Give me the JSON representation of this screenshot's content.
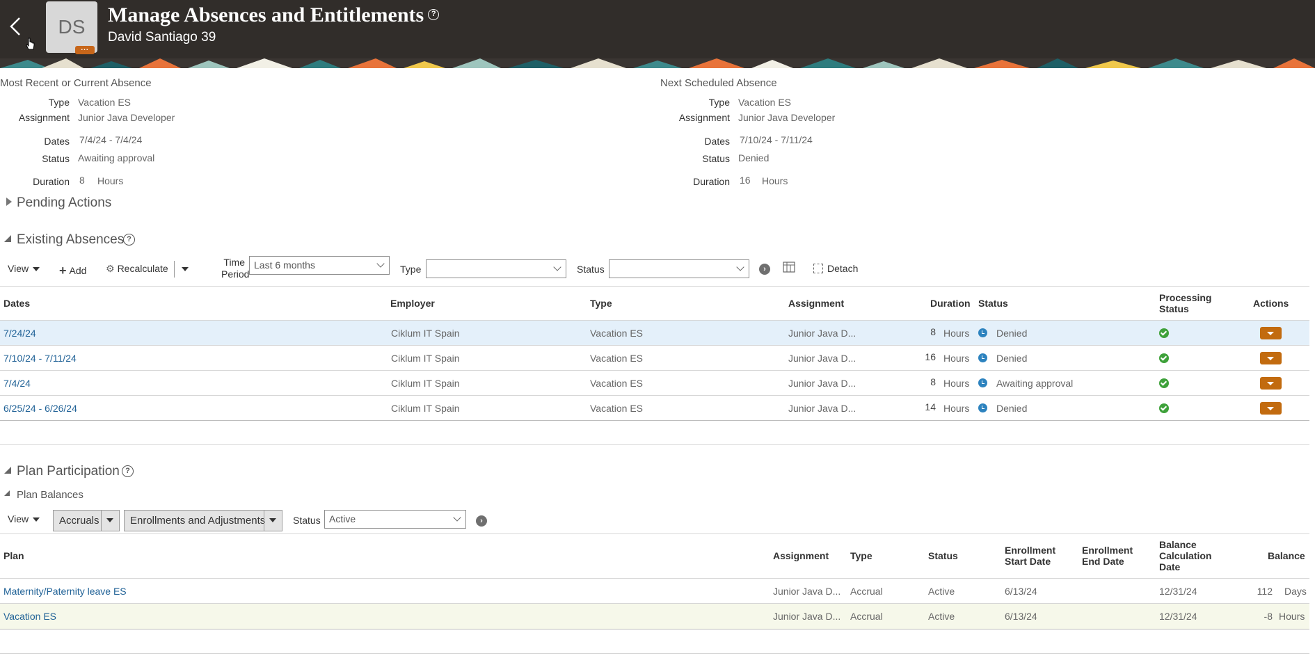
{
  "header": {
    "title": "Manage Absences and Entitlements",
    "person": "David Santiago 39",
    "avatar_initials": "DS",
    "help_glyph": "?"
  },
  "summary": {
    "current": {
      "heading": "Most Recent or Current Absence",
      "type_label": "Type",
      "type_value": "Vacation ES",
      "assignment_label": "Assignment",
      "assignment_value": "Junior Java Developer",
      "dates_label": "Dates",
      "dates_value": "7/4/24 - 7/4/24",
      "status_label": "Status",
      "status_value": "Awaiting approval",
      "duration_label": "Duration",
      "duration_value": "8",
      "duration_unit": "Hours"
    },
    "next": {
      "heading": "Next Scheduled Absence",
      "type_label": "Type",
      "type_value": "Vacation ES",
      "assignment_label": "Assignment",
      "assignment_value": "Junior Java Developer",
      "dates_label": "Dates",
      "dates_value": "7/10/24 - 7/11/24",
      "status_label": "Status",
      "status_value": "Denied",
      "duration_label": "Duration",
      "duration_value": "16",
      "duration_unit": "Hours"
    }
  },
  "pending": {
    "title": "Pending Actions"
  },
  "existing": {
    "title": "Existing Absences",
    "toolbar": {
      "view": "View",
      "add": "Add",
      "recalculate": "Recalculate",
      "time_period_label_1": "Time",
      "time_period_label_2": "Period",
      "time_period_value": "Last 6 months",
      "type_label": "Type",
      "type_value": "",
      "status_label": "Status",
      "status_value": "",
      "detach": "Detach"
    },
    "columns": {
      "dates": "Dates",
      "employer": "Employer",
      "type": "Type",
      "assignment": "Assignment",
      "duration": "Duration",
      "status": "Status",
      "proc_1": "Processing",
      "proc_2": "Status",
      "actions": "Actions"
    },
    "rows": [
      {
        "dates": "7/24/24",
        "employer": "Ciklum IT Spain",
        "type": "Vacation ES",
        "assignment": "Junior Java D...",
        "duration": "8",
        "unit": "Hours",
        "status": "Denied"
      },
      {
        "dates": "7/10/24 - 7/11/24",
        "employer": "Ciklum IT Spain",
        "type": "Vacation ES",
        "assignment": "Junior Java D...",
        "duration": "16",
        "unit": "Hours",
        "status": "Denied"
      },
      {
        "dates": "7/4/24",
        "employer": "Ciklum IT Spain",
        "type": "Vacation ES",
        "assignment": "Junior Java D...",
        "duration": "8",
        "unit": "Hours",
        "status": "Awaiting approval"
      },
      {
        "dates": "6/25/24 - 6/26/24",
        "employer": "Ciklum IT Spain",
        "type": "Vacation ES",
        "assignment": "Junior Java D...",
        "duration": "14",
        "unit": "Hours",
        "status": "Denied"
      }
    ]
  },
  "plan": {
    "title": "Plan Participation",
    "balances_title": "Plan Balances",
    "toolbar": {
      "view": "View",
      "accruals": "Accruals",
      "enrollments": "Enrollments and Adjustments",
      "status_label": "Status",
      "status_value": "Active"
    },
    "columns": {
      "plan": "Plan",
      "assignment": "Assignment",
      "type": "Type",
      "status": "Status",
      "enroll_start_1": "Enrollment",
      "enroll_start_2": "Start Date",
      "enroll_end_1": "Enrollment",
      "enroll_end_2": "End Date",
      "balcalc_1": "Balance",
      "balcalc_2": "Calculation",
      "balcalc_3": "Date",
      "balance": "Balance"
    },
    "rows": [
      {
        "plan": "Maternity/Paternity leave ES",
        "assignment": "Junior Java D...",
        "type": "Accrual",
        "status": "Active",
        "start": "6/13/24",
        "end": "",
        "calc": "12/31/24",
        "balance": "112",
        "unit": "Days"
      },
      {
        "plan": "Vacation ES",
        "assignment": "Junior Java D...",
        "type": "Accrual",
        "status": "Active",
        "start": "6/13/24",
        "end": "",
        "calc": "12/31/24",
        "balance": "-8",
        "unit": "Hours"
      }
    ]
  },
  "colors": {
    "header_bg": "#312d2a",
    "link": "#1f6196",
    "action": "#c26b0f",
    "selected_row": "#e4f0fa"
  }
}
